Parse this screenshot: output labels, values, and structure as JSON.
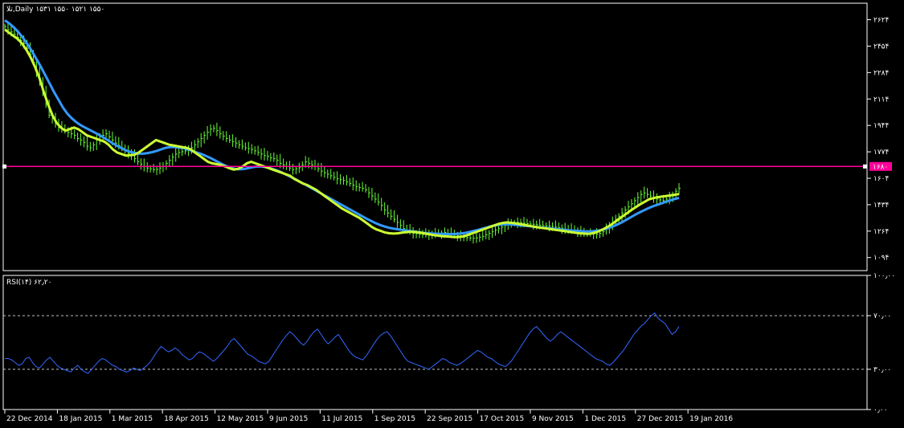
{
  "header": {
    "main_title": "تلا,Daily  ۱۵۳۱ ۱۵۵۰ ۱۵۲۱ ۱۵۵۰",
    "rsi_title": "RSI(۱۴) ۶۲٫۲۰"
  },
  "colors": {
    "background": "#000000",
    "frame": "#ffffff",
    "bull_bar": "#66ff33",
    "ma_fast": "#ccff33",
    "ma_slow": "#3399ff",
    "level_line": "#ff0099",
    "level_tag": "#ff0099",
    "rsi_line": "#3366ff",
    "rsi_levels": "#c0c0c0"
  },
  "chart_data": [
    {
      "type": "line",
      "name": "price-panel",
      "x_dates": [
        "22 Dec 2014",
        "18 Jan 2015",
        "1 Mar 2015",
        "18 Apr 2015",
        "12 May 2015",
        "9 Jun 2015",
        "11 Jul 2015",
        "1 Sep 2015",
        "22 Sep 2015",
        "17 Oct 2015",
        "9 Nov 2015",
        "1 Dec 2015",
        "27 Dec 2015",
        "19 Jan 2016"
      ],
      "y_tick_labels": [
        "۲۶۲۴",
        "۲۴۵۴",
        "۲۲۸۴",
        "۲۱۱۴",
        "۱۹۴۴",
        "۱۷۷۴",
        "۱۶۰۴",
        "۱۴۳۴",
        "۱۲۶۴",
        "۱۰۹۴"
      ],
      "y_ticks": [
        2624,
        2454,
        2284,
        2114,
        1944,
        1774,
        1604,
        1434,
        1264,
        1094
      ],
      "ylim": [
        1010,
        2730
      ],
      "current_price_label": "۱۶۸۰",
      "current_price": 1680,
      "series": [
        {
          "role": "close",
          "values": [
            2580,
            2560,
            2545,
            2530,
            2510,
            2490,
            2470,
            2440,
            2400,
            2350,
            2290,
            2230,
            2160,
            2080,
            2010,
            1990,
            1960,
            1930,
            1920,
            1910,
            1900,
            1890,
            1880,
            1860,
            1850,
            1835,
            1810,
            1800,
            1820,
            1850,
            1870,
            1880,
            1890,
            1870,
            1850,
            1830,
            1815,
            1800,
            1780,
            1765,
            1750,
            1730,
            1710,
            1695,
            1680,
            1670,
            1665,
            1660,
            1662,
            1670,
            1680,
            1700,
            1720,
            1740,
            1760,
            1770,
            1775,
            1780,
            1790,
            1800,
            1820,
            1840,
            1860,
            1880,
            1900,
            1920,
            1925,
            1910,
            1890,
            1875,
            1860,
            1850,
            1840,
            1830,
            1820,
            1810,
            1800,
            1795,
            1790,
            1780,
            1770,
            1760,
            1750,
            1745,
            1735,
            1730,
            1720,
            1700,
            1690,
            1680,
            1670,
            1660,
            1665,
            1672,
            1690,
            1710,
            1700,
            1690,
            1680,
            1665,
            1650,
            1640,
            1630,
            1620,
            1610,
            1600,
            1595,
            1590,
            1580,
            1570,
            1560,
            1550,
            1545,
            1540,
            1530,
            1510,
            1490,
            1470,
            1450,
            1430,
            1400,
            1380,
            1360,
            1340,
            1320,
            1300,
            1280,
            1270,
            1260,
            1250,
            1248,
            1245,
            1242,
            1240,
            1242,
            1245,
            1248,
            1250,
            1252,
            1255,
            1250,
            1245,
            1240,
            1235,
            1230,
            1225,
            1222,
            1220,
            1218,
            1220,
            1225,
            1230,
            1240,
            1250,
            1260,
            1270,
            1280,
            1290,
            1300,
            1310,
            1315,
            1318,
            1320,
            1318,
            1315,
            1312,
            1310,
            1308,
            1305,
            1302,
            1300,
            1298,
            1296,
            1294,
            1290,
            1286,
            1282,
            1278,
            1274,
            1270,
            1266,
            1262,
            1258,
            1254,
            1250,
            1248,
            1246,
            1245,
            1250,
            1260,
            1280,
            1300,
            1320,
            1340,
            1360,
            1380,
            1400,
            1420,
            1440,
            1460,
            1480,
            1500,
            1510,
            1500,
            1490,
            1480,
            1470,
            1465,
            1460,
            1470,
            1480,
            1490,
            1520,
            1540
          ]
        },
        {
          "role": "ma-fast",
          "values": [
            2560,
            2540,
            2520,
            2500,
            2470,
            2430,
            2380,
            2320,
            2250,
            2160,
            2080,
            2010,
            1960,
            1930,
            1910,
            1920,
            1930,
            1920,
            1900,
            1880,
            1870,
            1860,
            1850,
            1840,
            1820,
            1790,
            1770,
            1760,
            1750,
            1752,
            1755,
            1770,
            1790,
            1810,
            1830,
            1850,
            1840,
            1830,
            1820,
            1815,
            1810,
            1805,
            1800,
            1790,
            1770,
            1750,
            1730,
            1710,
            1700,
            1695,
            1690,
            1680,
            1668,
            1660,
            1665,
            1680,
            1700,
            1710,
            1700,
            1690,
            1680,
            1670,
            1660,
            1650,
            1640,
            1630,
            1620,
            1600,
            1585,
            1570,
            1560,
            1545,
            1530,
            1510,
            1490,
            1470,
            1450,
            1430,
            1410,
            1395,
            1380,
            1365,
            1350,
            1330,
            1310,
            1290,
            1275,
            1265,
            1255,
            1250,
            1248,
            1250,
            1255,
            1258,
            1260,
            1258,
            1255,
            1250,
            1245,
            1240,
            1236,
            1232,
            1230,
            1228,
            1226,
            1226,
            1230,
            1238,
            1248,
            1258,
            1268,
            1278,
            1288,
            1298,
            1308,
            1316,
            1320,
            1318,
            1315,
            1310,
            1305,
            1300,
            1295,
            1290,
            1286,
            1282,
            1278,
            1274,
            1270,
            1266,
            1262,
            1258,
            1254,
            1250,
            1248,
            1246,
            1250,
            1258,
            1270,
            1285,
            1300,
            1320,
            1340,
            1360,
            1380,
            1400,
            1418,
            1436,
            1452,
            1468,
            1476,
            1482,
            1486,
            1490,
            1494,
            1498,
            1502
          ]
        },
        {
          "role": "ma-slow",
          "values": [
            2620,
            2600,
            2575,
            2545,
            2510,
            2470,
            2425,
            2375,
            2325,
            2270,
            2215,
            2160,
            2110,
            2060,
            2020,
            1990,
            1965,
            1945,
            1930,
            1915,
            1900,
            1885,
            1868,
            1850,
            1832,
            1815,
            1800,
            1785,
            1775,
            1768,
            1762,
            1762,
            1766,
            1772,
            1780,
            1790,
            1800,
            1805,
            1805,
            1802,
            1798,
            1790,
            1780,
            1770,
            1760,
            1748,
            1735,
            1720,
            1705,
            1690,
            1678,
            1668,
            1662,
            1662,
            1666,
            1672,
            1678,
            1680,
            1678,
            1672,
            1664,
            1654,
            1642,
            1628,
            1614,
            1600,
            1584,
            1568,
            1552,
            1536,
            1520,
            1504,
            1488,
            1472,
            1456,
            1440,
            1424,
            1408,
            1392,
            1376,
            1360,
            1344,
            1330,
            1316,
            1304,
            1294,
            1286,
            1280,
            1276,
            1272,
            1268,
            1264,
            1260,
            1256,
            1252,
            1250,
            1248,
            1247,
            1246,
            1245,
            1245,
            1246,
            1248,
            1252,
            1258,
            1265,
            1272,
            1280,
            1288,
            1296,
            1302,
            1306,
            1308,
            1308,
            1306,
            1303,
            1300,
            1297,
            1294,
            1291,
            1288,
            1285,
            1282,
            1279,
            1276,
            1273,
            1270,
            1268,
            1266,
            1264,
            1262,
            1262,
            1264,
            1268,
            1274,
            1282,
            1292,
            1304,
            1318,
            1334,
            1350,
            1366,
            1382,
            1396,
            1410,
            1422,
            1432,
            1442,
            1452,
            1462,
            1470,
            1478
          ]
        }
      ]
    },
    {
      "type": "line",
      "name": "rsi-panel",
      "y_tick_labels": [
        "۱۰۰٫۰۰",
        "۷۰٫۰۰",
        "۳۰٫۰۰",
        "۰٫۰۰"
      ],
      "y_ticks": [
        100,
        70,
        30,
        0
      ],
      "levels": [
        70,
        30
      ],
      "ylim": [
        0,
        100
      ],
      "values": [
        38,
        38,
        37,
        35,
        33,
        34,
        38,
        39,
        35,
        32,
        31,
        34,
        37,
        39,
        36,
        33,
        31,
        30,
        29,
        28,
        31,
        33,
        30,
        28,
        27,
        30,
        33,
        36,
        38,
        37,
        35,
        33,
        32,
        30,
        29,
        28,
        29,
        31,
        30,
        29,
        31,
        33,
        36,
        40,
        44,
        47,
        45,
        43,
        44,
        46,
        44,
        41,
        39,
        37,
        38,
        41,
        43,
        42,
        40,
        38,
        36,
        38,
        41,
        44,
        47,
        51,
        53,
        50,
        47,
        44,
        41,
        40,
        38,
        36,
        35,
        34,
        36,
        40,
        44,
        48,
        52,
        55,
        58,
        56,
        53,
        50,
        48,
        51,
        55,
        58,
        60,
        56,
        52,
        49,
        51,
        54,
        56,
        52,
        48,
        44,
        41,
        39,
        38,
        37,
        40,
        44,
        48,
        52,
        55,
        57,
        58,
        55,
        51,
        47,
        43,
        39,
        36,
        35,
        34,
        33,
        32,
        31,
        30,
        32,
        34,
        36,
        38,
        37,
        35,
        34,
        33,
        34,
        36,
        38,
        40,
        42,
        44,
        43,
        41,
        39,
        38,
        36,
        34,
        33,
        32,
        34,
        37,
        41,
        45,
        49,
        53,
        57,
        60,
        62,
        59,
        56,
        53,
        51,
        53,
        56,
        58,
        56,
        54,
        52,
        50,
        48,
        46,
        44,
        42,
        40,
        38,
        37,
        36,
        34,
        33,
        35,
        38,
        41,
        44,
        48,
        52,
        56,
        59,
        62,
        64,
        67,
        70,
        72,
        68,
        66,
        64,
        60,
        56,
        58,
        62
      ]
    }
  ]
}
